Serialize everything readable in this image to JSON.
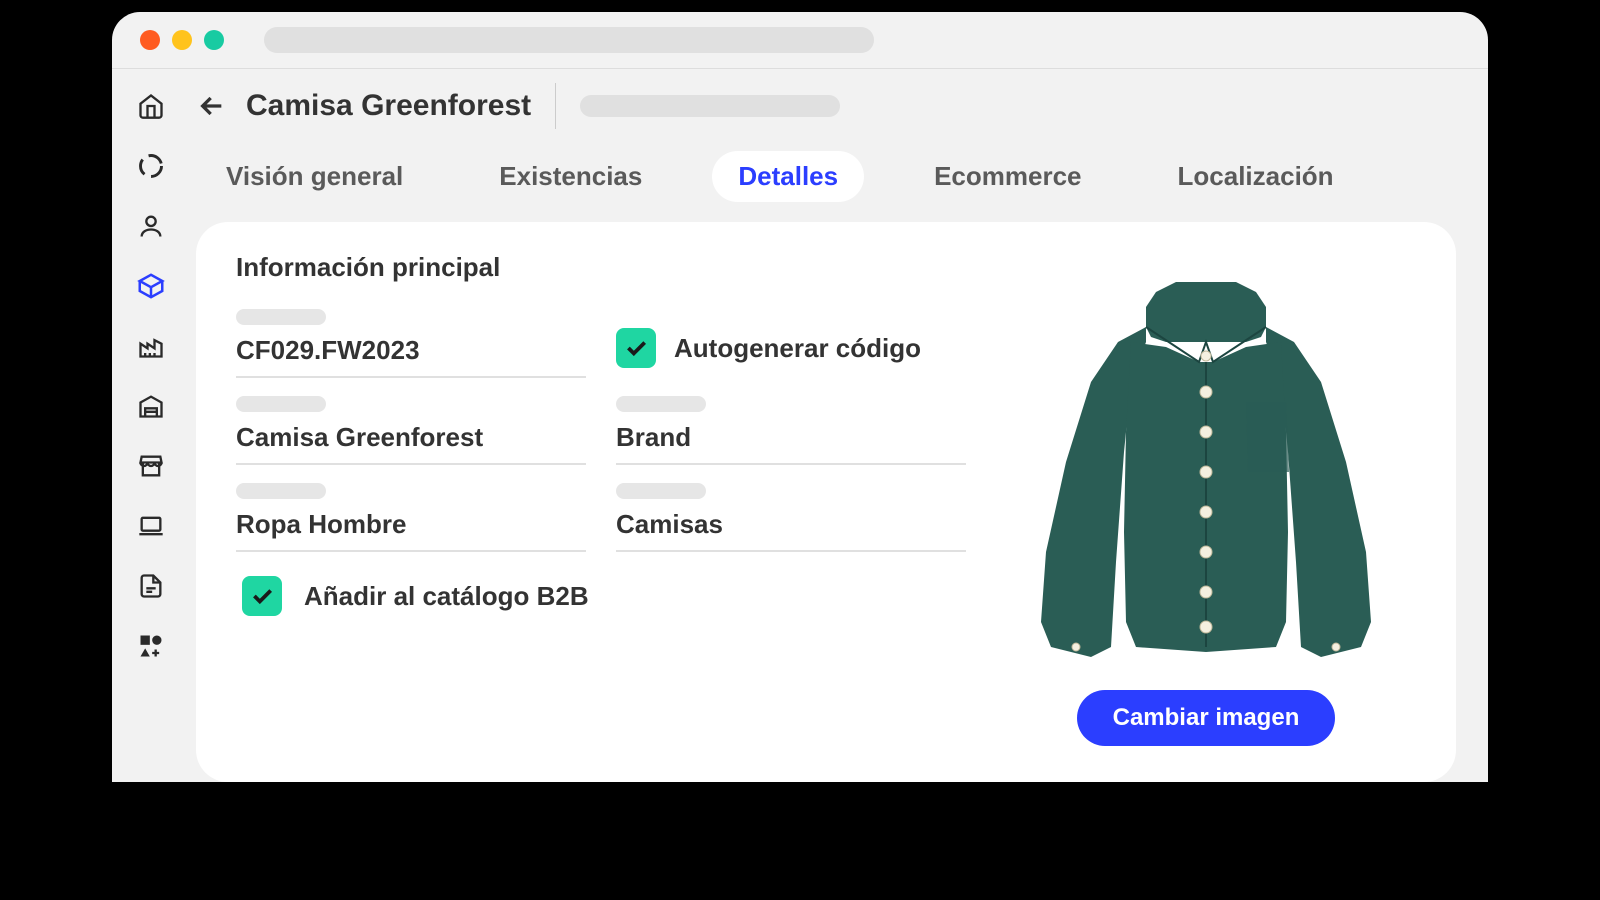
{
  "header": {
    "title": "Camisa Greenforest"
  },
  "tabs": [
    {
      "label": "Visión general",
      "active": false
    },
    {
      "label": "Existencias",
      "active": false
    },
    {
      "label": "Detalles",
      "active": true
    },
    {
      "label": "Ecommerce",
      "active": false
    },
    {
      "label": "Localización",
      "active": false
    }
  ],
  "section": {
    "title": "Información principal",
    "fields": {
      "code": "CF029.FW2023",
      "autogen_label": "Autogenerar código",
      "name": "Camisa Greenforest",
      "brand": "Brand",
      "category": "Ropa Hombre",
      "subcategory": "Camisas"
    },
    "b2b_label": "Añadir al catálogo B2B"
  },
  "image": {
    "change_button": "Cambiar imagen"
  },
  "colors": {
    "accent": "#2b3eff",
    "checkbox": "#1fd6a2",
    "shirt": "#2a5d55"
  }
}
